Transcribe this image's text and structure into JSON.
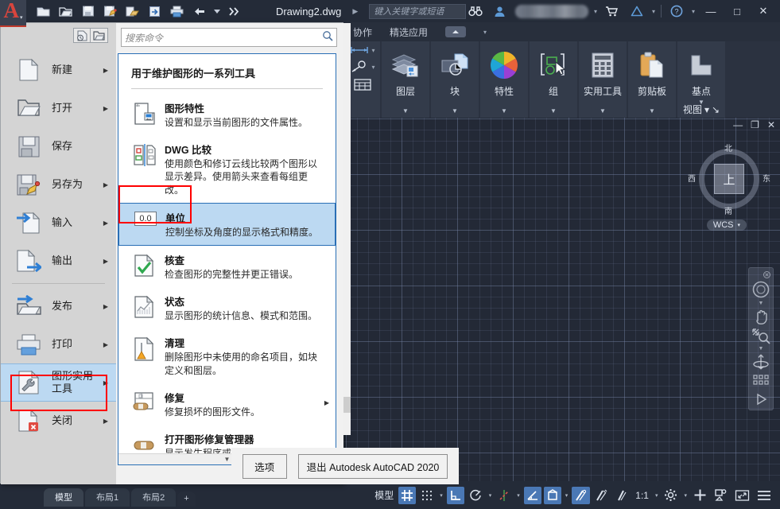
{
  "titlebar": {
    "logo_letter": "A",
    "document_name": "Drawing2.dwg",
    "search_placeholder": "键入关键字或短语",
    "quick_access": [
      {
        "name": "new-file-icon",
        "tip": "新建"
      },
      {
        "name": "open-file-icon",
        "tip": "打开"
      },
      {
        "name": "save-icon",
        "tip": "保存"
      },
      {
        "name": "save-as-icon",
        "tip": "另存为"
      },
      {
        "name": "plot-open-icon",
        "tip": "打印预览"
      },
      {
        "name": "share-icon",
        "tip": "共享"
      },
      {
        "name": "print-icon",
        "tip": "打印"
      },
      {
        "name": "undo-icon",
        "tip": "放弃"
      },
      {
        "name": "undo-dropdown-icon",
        "tip": "放弃列表"
      },
      {
        "name": "more-icon",
        "tip": "更多"
      }
    ],
    "window_buttons": {
      "minimize": "—",
      "maximize": "□",
      "close": "✕"
    }
  },
  "ribbon": {
    "tabs": [
      "协作",
      "精选应用"
    ],
    "panels": [
      {
        "label": "图层",
        "icon": "layers-icon"
      },
      {
        "label": "块",
        "icon": "block-icon"
      },
      {
        "label": "特性",
        "icon": "properties-wheel-icon"
      },
      {
        "label": "组",
        "icon": "group-icon"
      },
      {
        "label": "实用工具",
        "icon": "calculator-icon"
      },
      {
        "label": "剪贴板",
        "icon": "clipboard-icon"
      },
      {
        "label": "基点",
        "icon": "basepoint-icon",
        "sub_label": "视图"
      }
    ]
  },
  "canvas": {
    "viewcube": {
      "center": "上",
      "north": "北",
      "south": "南",
      "west": "西",
      "east": "东"
    },
    "ucs_label": "WCS",
    "viewport_buttons": {
      "minimize": "—",
      "restore": "❐",
      "close": "✕"
    },
    "nav_tools": [
      "full-navigation-wheel-icon",
      "pan-icon",
      "zoom-extents-icon",
      "orbit-icon",
      "showmotion-icon",
      "play-icon"
    ]
  },
  "statusbar": {
    "drawing_tabs": [
      {
        "label": "模型",
        "active": true
      },
      {
        "label": "布局1",
        "active": false
      },
      {
        "label": "布局2",
        "active": false
      },
      {
        "label": "+",
        "active": false
      }
    ],
    "model_label": "模型",
    "scale": "1:1",
    "items": [
      {
        "name": "grid-display-toggle",
        "on": true
      },
      {
        "name": "snap-mode-toggle",
        "on": false
      },
      {
        "name": "ortho-mode-toggle",
        "on": true
      },
      {
        "name": "polar-tracking-toggle",
        "on": false
      },
      {
        "name": "object-snap-tracking-toggle",
        "on": false
      },
      {
        "name": "isometric-drafting-toggle",
        "on": true
      },
      {
        "name": "object-snap-toggle",
        "on": true
      },
      {
        "name": "lineweight-toggle",
        "on": true
      },
      {
        "name": "transparency-toggle",
        "on": false
      },
      {
        "name": "selection-cycling-toggle",
        "on": false
      },
      {
        "name": "annotation-scale",
        "on": false
      },
      {
        "name": "workspace-settings",
        "on": false
      },
      {
        "name": "customization",
        "on": false
      },
      {
        "name": "isolate-objects",
        "on": false
      },
      {
        "name": "clean-screen",
        "on": false
      },
      {
        "name": "hamburger-menu",
        "on": false
      }
    ]
  },
  "appmenu": {
    "search_placeholder": "搜索命令",
    "toggles": [
      {
        "name": "recent-documents-toggle",
        "label": ""
      },
      {
        "name": "open-documents-toggle",
        "label": ""
      }
    ],
    "items": [
      {
        "label": "新建",
        "icon": "new-doc-icon",
        "arrow": true,
        "selected": false,
        "divider_after": false
      },
      {
        "label": "打开",
        "icon": "open-folder-icon",
        "arrow": true,
        "selected": false,
        "divider_after": false
      },
      {
        "label": "保存",
        "icon": "floppy-save-icon",
        "arrow": false,
        "selected": false,
        "divider_after": false
      },
      {
        "label": "另存为",
        "icon": "save-as-pencil-icon",
        "arrow": true,
        "selected": false,
        "divider_after": false
      },
      {
        "label": "输入",
        "icon": "import-icon",
        "arrow": true,
        "selected": false,
        "divider_after": false
      },
      {
        "label": "输出",
        "icon": "export-icon",
        "arrow": true,
        "selected": false,
        "divider_after": true
      },
      {
        "label": "发布",
        "icon": "publish-icon",
        "arrow": true,
        "selected": false,
        "divider_after": false
      },
      {
        "label": "打印",
        "icon": "printer-icon",
        "arrow": true,
        "selected": false,
        "divider_after": false
      },
      {
        "label": "图形实用\n工具",
        "icon": "drawing-utilities-icon",
        "arrow": true,
        "selected": true,
        "divider_after": false
      },
      {
        "label": "关闭",
        "icon": "close-doc-icon",
        "arrow": true,
        "selected": false,
        "divider_after": false
      }
    ],
    "submenu": {
      "header": "用于维护图形的一系列工具",
      "entries": [
        {
          "title": "图形特性",
          "desc": "设置和显示当前图形的文件属性。",
          "icon": "drawing-properties-icon",
          "arrow": false,
          "selected": false
        },
        {
          "title": "DWG 比较",
          "desc": "使用颜色和修订云线比较两个图形以显示差异。使用箭头来查看每组更改。",
          "icon": "dwg-compare-icon",
          "arrow": false,
          "selected": false
        },
        {
          "title": "单位",
          "desc": "控制坐标及角度的显示格式和精度。",
          "icon": "units-icon",
          "icon_text": "0.0",
          "arrow": false,
          "selected": true
        },
        {
          "title": "核查",
          "desc": "检查图形的完整性并更正错误。",
          "icon": "audit-check-icon",
          "arrow": false,
          "selected": false
        },
        {
          "title": "状态",
          "desc": "显示图形的统计信息、模式和范围。",
          "icon": "status-chart-icon",
          "arrow": false,
          "selected": false
        },
        {
          "title": "清理",
          "desc": "删除图形中未使用的命名项目，如块定义和图层。",
          "icon": "purge-broom-icon",
          "arrow": false,
          "selected": false
        },
        {
          "title": "修复",
          "desc": "修复损坏的图形文件。",
          "icon": "recover-icon",
          "arrow": true,
          "selected": false
        },
        {
          "title": "打开图形修复管理器",
          "desc": "显示发生程序或系统故障后可能需要修复",
          "icon": "drawing-recovery-manager-icon",
          "arrow": false,
          "selected": false
        }
      ]
    },
    "footer": {
      "options_label": "选项",
      "exit_label": "退出 Autodesk AutoCAD 2020"
    }
  },
  "colors": {
    "accent_blue": "#4a78b5",
    "highlight_red": "#ff0000",
    "menu_bg": "#d6d6d6",
    "selection_blue": "#bcd9f2",
    "canvas_bg": "#232936"
  }
}
